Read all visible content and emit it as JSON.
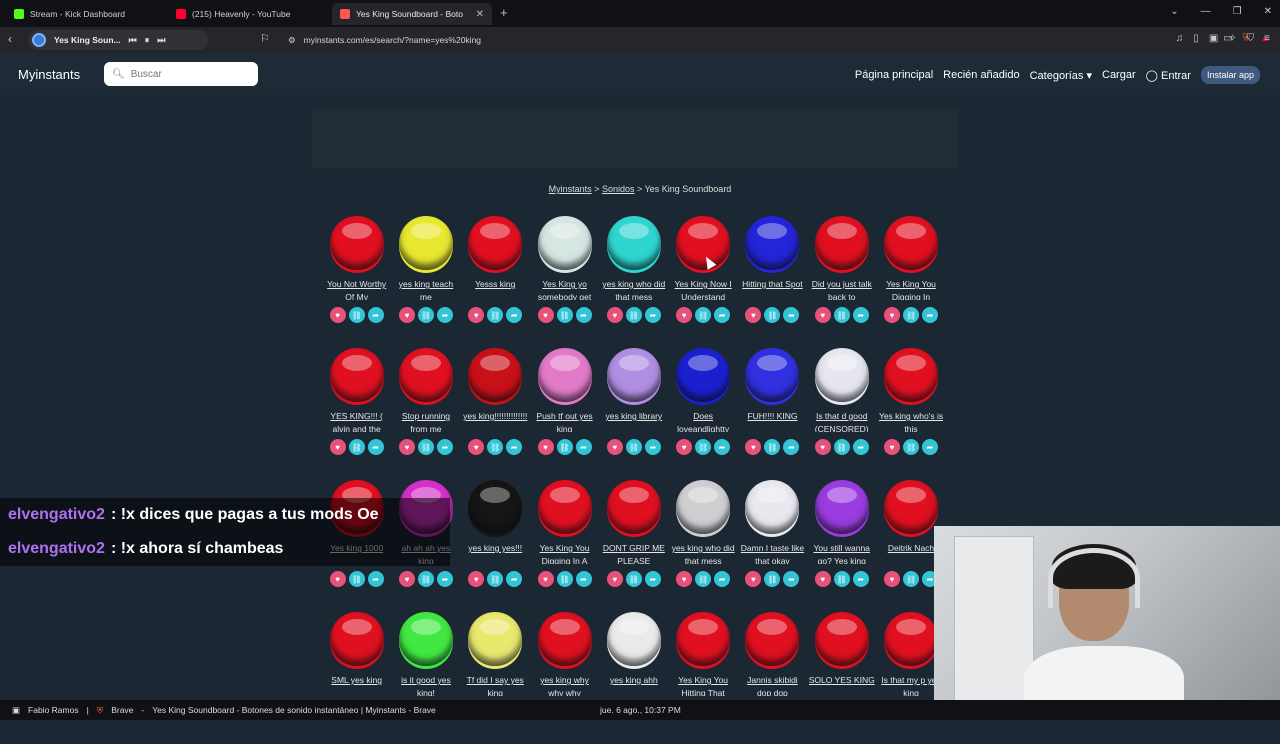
{
  "browser": {
    "tabs": [
      {
        "title": "Stream - Kick Dashboard",
        "favicon_color": "#53fc18"
      },
      {
        "title": "(215) Heavenly - YouTube",
        "favicon_color": "#ff0033"
      },
      {
        "title": "Yes King Soundboard - Boto",
        "favicon_color": "#ff5555"
      }
    ],
    "media_title": "Yes King Soun...",
    "url": "myinstants.com/es/search/?name=yes%20king"
  },
  "site": {
    "logo": "Myinstants",
    "search_placeholder": "Buscar",
    "menu": [
      "Página principal",
      "Recién añadido",
      "Categorías",
      "Cargar",
      "Entrar"
    ],
    "install": "Instalar app"
  },
  "breadcrumb": {
    "home": "Myinstants",
    "sounds": "Sonidos",
    "current": "Yes King Soundboard"
  },
  "sounds": [
    {
      "label": "You Not Worthy Of My",
      "color": "#e01020"
    },
    {
      "label": "yes king teach me",
      "color": "#e8e830"
    },
    {
      "label": "Yesss king",
      "color": "#e01020"
    },
    {
      "label": "Yes King yo somebody get",
      "color": "#d6e6e2"
    },
    {
      "label": "yes king who did that mess",
      "color": "#2fd6d0"
    },
    {
      "label": "Yes King Now I Understand",
      "color": "#e01020"
    },
    {
      "label": "Hitting that Spot",
      "color": "#2424d8"
    },
    {
      "label": "Did you just talk back to",
      "color": "#e01020"
    },
    {
      "label": "Yes King You Digging In",
      "color": "#e01020"
    },
    {
      "label": "YES KING!!! ( alvin and the",
      "color": "#e01020"
    },
    {
      "label": "Stop running from me",
      "color": "#e01020"
    },
    {
      "label": "yes king!!!!!!!!!!!!!!",
      "color": "#c81018"
    },
    {
      "label": "Push tf out yes king",
      "color": "#e27ac8"
    },
    {
      "label": "yes king library",
      "color": "#b08ee2"
    },
    {
      "label": "Does loveandlightty",
      "color": "#1a20d0"
    },
    {
      "label": "FUH!!!! KING",
      "color": "#3030e0"
    },
    {
      "label": "Is that d good (CENSORED)",
      "color": "#e6e6ee"
    },
    {
      "label": "Yes king who's is this",
      "color": "#e01020"
    },
    {
      "label": "Yes king 1000",
      "color": "#e01020"
    },
    {
      "label": "ah ah ah yes king",
      "color": "#d430c8"
    },
    {
      "label": "yes king yes!!!",
      "color": "#151515"
    },
    {
      "label": "Yes King You Digging In A",
      "color": "#e01020"
    },
    {
      "label": "DONT GRIP ME PLEASE",
      "color": "#e01020"
    },
    {
      "label": "yes king who did that mess",
      "color": "#cfcfd2"
    },
    {
      "label": "Damn I taste like that okay",
      "color": "#e8e8ee"
    },
    {
      "label": "You still wanna go? Yes king",
      "color": "#9a3ce0"
    },
    {
      "label": "Deitrik Nach",
      "color": "#e01020"
    },
    {
      "label": "SML yes king",
      "color": "#e01020"
    },
    {
      "label": "is it good yes king!",
      "color": "#42e842"
    },
    {
      "label": "Tf did I say yes king",
      "color": "#e8e86e"
    },
    {
      "label": "yes king why why why",
      "color": "#e01020"
    },
    {
      "label": "yes king ahh",
      "color": "#eaeaea"
    },
    {
      "label": "Yes King You Hitting That",
      "color": "#e01020"
    },
    {
      "label": "Jannis skibidi dop dop",
      "color": "#e01020"
    },
    {
      "label": "SOLO YES KING",
      "color": "#e01020"
    },
    {
      "label": "Is that my p yes king",
      "color": "#e01020"
    }
  ],
  "chat": [
    {
      "user": "elvengativo2",
      "message": ": !x dices que pagas a tus mods Oe"
    },
    {
      "user": "elvengativo2",
      "message": ": !x ahora sí chambeas"
    }
  ],
  "taskbar": {
    "user": "Fabio Ramos",
    "app": "Brave",
    "window_title": "Yes King Soundboard - Botones de sonido instantáneo | Myinstants - Brave",
    "clock": "jue. 6 ago., 10:37 PM"
  }
}
